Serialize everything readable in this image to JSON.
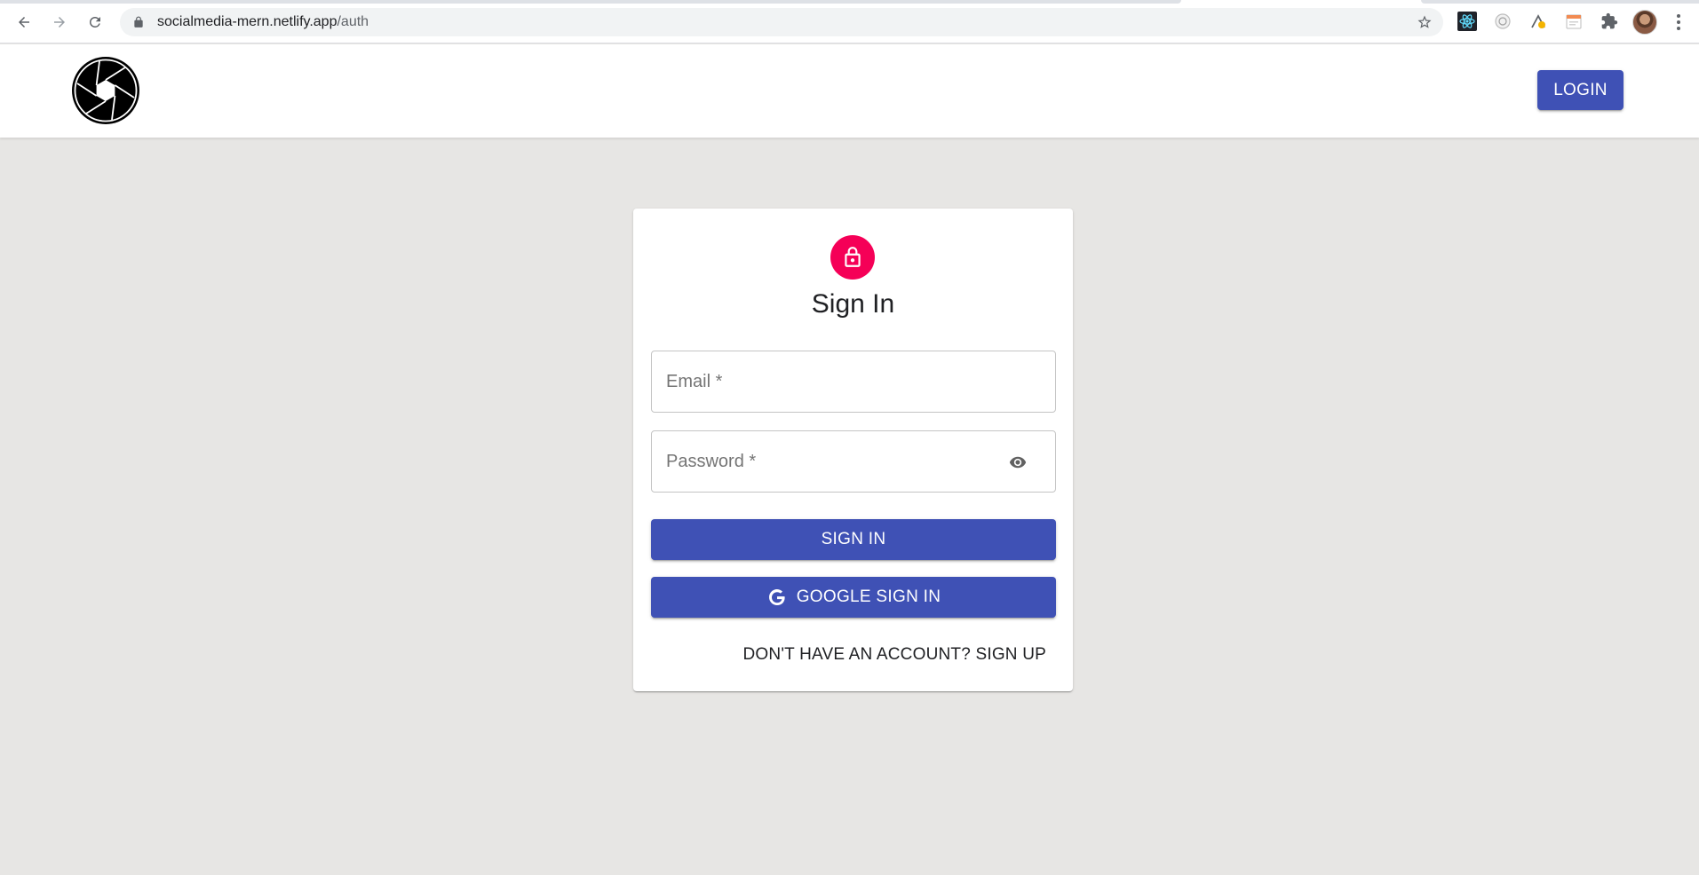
{
  "browser": {
    "url_host": "socialmedia-mern.netlify.app",
    "url_path": "/auth",
    "icons": [
      "back-icon",
      "forward-icon",
      "reload-icon",
      "lock-icon",
      "star-icon",
      "react-devtools-icon",
      "extension-icon",
      "extension-icon",
      "extension-icon",
      "puzzle-icon",
      "avatar",
      "kebab-menu-icon"
    ]
  },
  "appbar": {
    "logo": "camera-shutter-logo",
    "login_label": "LOGIN",
    "accent": "#3f51b5"
  },
  "auth": {
    "title": "Sign In",
    "lock_color": "#f50057",
    "email_placeholder": "Email *",
    "password_placeholder": "Password *",
    "sign_in_label": "SIGN IN",
    "google_label": "GOOGLE SIGN IN",
    "switch_label": "DON'T HAVE AN ACCOUNT? SIGN UP"
  }
}
